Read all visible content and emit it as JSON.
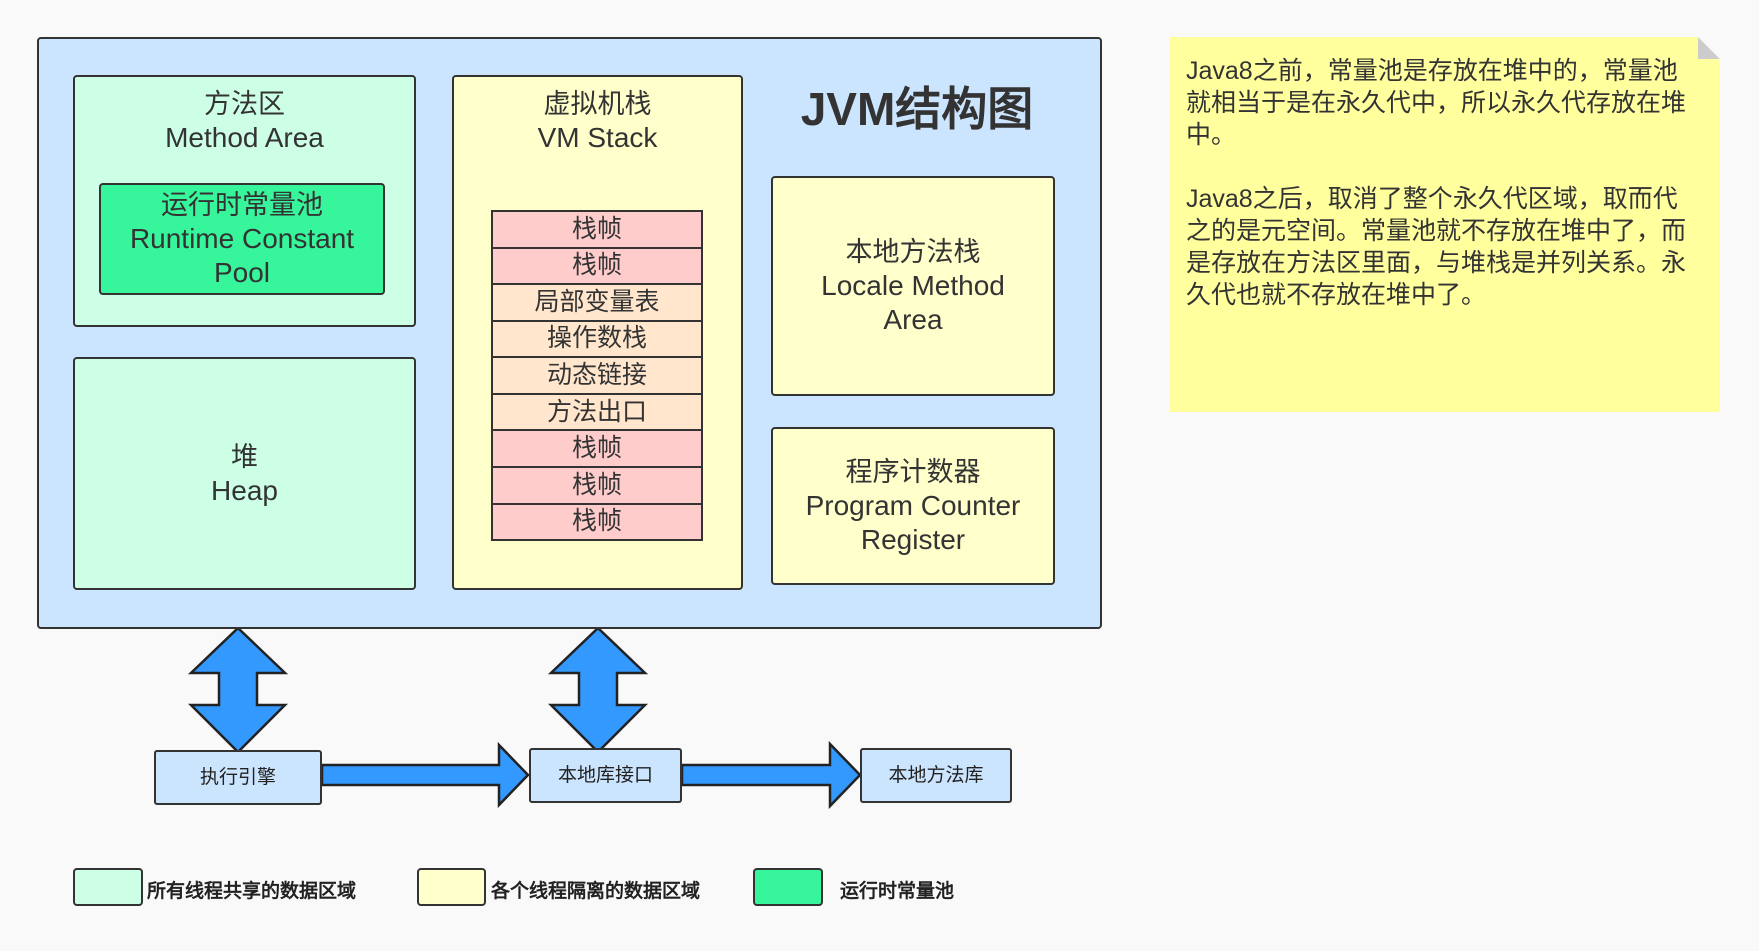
{
  "colors": {
    "background": "#f9f9f9",
    "jvm_box": "#cce5ff",
    "shared_area": "#ccffe6",
    "thread_private_area": "#ffffcc",
    "runtime_constant_pool": "#36f59b",
    "stack_frame": "#ffcccc",
    "frame_section": "#ffe6cc",
    "note": "#ffff9e",
    "note_fold": "#cccccc",
    "arrow": "#3399ff",
    "interface_box": "#cce5ff",
    "stroke": "#333333",
    "text": "#333333"
  },
  "title": "JVM结构图",
  "method_area": {
    "label_zh": "方法区",
    "label_en": "Method Area"
  },
  "runtime_constant_pool": {
    "label_zh": "运行时常量池",
    "label_en": "Runtime Constant Pool"
  },
  "heap": {
    "label_zh": "堆",
    "label_en": "Heap"
  },
  "vm_stack": {
    "label_zh": "虚拟机栈",
    "label_en": "VM Stack",
    "rows": [
      {
        "label": "栈帧",
        "color": "#ffcccc"
      },
      {
        "label": "栈帧",
        "color": "#ffcccc"
      },
      {
        "label": "局部变量表",
        "color": "#ffe6cc"
      },
      {
        "label": "操作数栈",
        "color": "#ffe6cc"
      },
      {
        "label": "动态链接",
        "color": "#ffe6cc"
      },
      {
        "label": "方法出口",
        "color": "#ffe6cc"
      },
      {
        "label": "栈帧",
        "color": "#ffcccc"
      },
      {
        "label": "栈帧",
        "color": "#ffcccc"
      },
      {
        "label": "栈帧",
        "color": "#ffcccc"
      }
    ]
  },
  "native_method_stack": {
    "label_zh": "本地方法栈",
    "label_en": "Locale Method Area"
  },
  "program_counter": {
    "label_zh": "程序计数器",
    "label_en": "Program Counter Register"
  },
  "execution_engine": {
    "label": "执行引擎"
  },
  "native_interface": {
    "label": "本地库接口"
  },
  "native_library": {
    "label": "本地方法库"
  },
  "note": {
    "paragraphs": [
      "Java8之前，常量池是存放在堆中的，常量池就相当于是在永久代中，所以永久代存放在堆中。",
      "Java8之后，取消了整个永久代区域，取而代之的是元空间。常量池就不存放在堆中了，而是存放在方法区里面，与堆栈是并列关系。永久代也就不存放在堆中了。"
    ]
  },
  "legend": [
    {
      "label": "所有线程共享的数据区域",
      "color": "#ccffe6"
    },
    {
      "label": "各个线程隔离的数据区域",
      "color": "#ffffcc"
    },
    {
      "label": "运行时常量池",
      "color": "#36f59b"
    }
  ]
}
